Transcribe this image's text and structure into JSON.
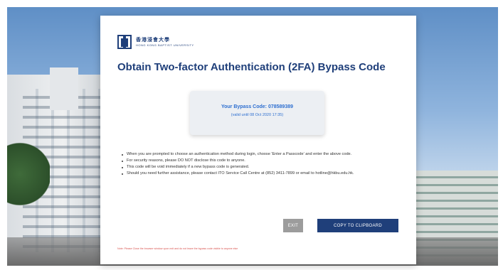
{
  "university": {
    "name_cn": "香港浸會大學",
    "name_en": "HONG KONG BAPTIST UNIVERSITY"
  },
  "page": {
    "title": "Obtain Two-factor Authentication (2FA) Bypass Code"
  },
  "bypass": {
    "code_text": "Your Bypass Code: 078589389",
    "valid_text": "(valid until 08 Oct 2020 17:35)"
  },
  "notes": [
    "When you are prompted to choose an authentication method during login, choose 'Enter a Passcode' and enter the above code.",
    "For security reasons, please DO NOT disclose this code to anyone.",
    "This code will be void immediately if a new bypass code is generated.",
    "Should you need further assistance, please contact ITO Service Call Centre at (852) 3411-7899 or email to hotline@hkbu.edu.hk."
  ],
  "buttons": {
    "exit": "EXIT",
    "copy": "COPY TO CLIPBOARD"
  },
  "footer_note": "Note: Please Close the browser window upon exit and do not leave the bypass code visible to anyone else",
  "colors": {
    "brand": "#1f3f7a",
    "accent": "#2e6fd0",
    "warning": "#d9534f",
    "exit_button": "#9c9c9c"
  }
}
